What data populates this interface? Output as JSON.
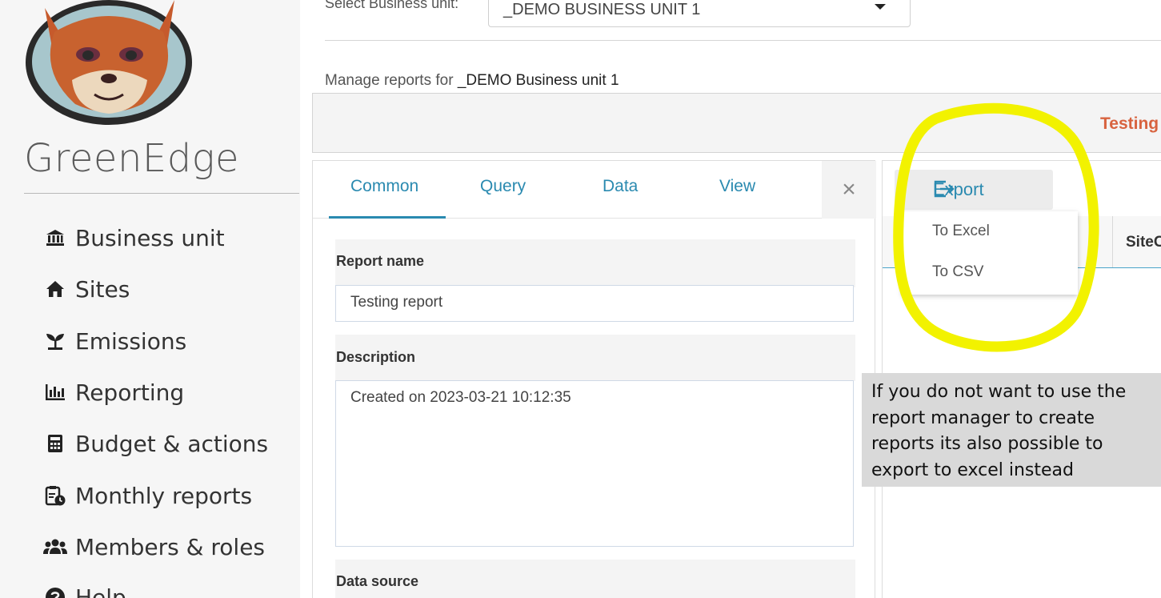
{
  "sidebar": {
    "brand": "GreenEdge",
    "items": [
      {
        "label": "Business unit",
        "icon": "bank-icon"
      },
      {
        "label": "Sites",
        "icon": "home-icon"
      },
      {
        "label": "Emissions",
        "icon": "seedling-icon"
      },
      {
        "label": "Reporting",
        "icon": "bar-chart-icon"
      },
      {
        "label": "Budget & actions",
        "icon": "calculator-icon"
      },
      {
        "label": "Monthly reports",
        "icon": "clipboard-clock-icon"
      },
      {
        "label": "Members & roles",
        "icon": "users-icon"
      },
      {
        "label": "Help",
        "icon": "help-icon"
      }
    ]
  },
  "header": {
    "business_unit_label": "Select Business unit:",
    "business_unit_value": "_DEMO BUSINESS UNIT 1",
    "manage_prefix": "Manage reports for",
    "manage_unit": "_DEMO Business unit 1",
    "report_title": "Testing report"
  },
  "editor": {
    "tabs": [
      "Common",
      "Query",
      "Data",
      "View"
    ],
    "close_symbol": "×",
    "report_name_label": "Report name",
    "report_name_value": "Testing report",
    "description_label": "Description",
    "description_value": "Created on 2023-03-21 10:12:35",
    "data_source_label": "Data source"
  },
  "export": {
    "button_label": "Export",
    "menu": [
      "To Excel",
      "To CSV"
    ],
    "grid_column": "SiteC"
  },
  "annotation": {
    "text": "If you do not want to use the report manager to create reports its also possible to export to excel instead",
    "highlight_color": "#f2f200"
  },
  "colors": {
    "accent": "#2a8ab0",
    "title_accent": "#d8633f"
  }
}
